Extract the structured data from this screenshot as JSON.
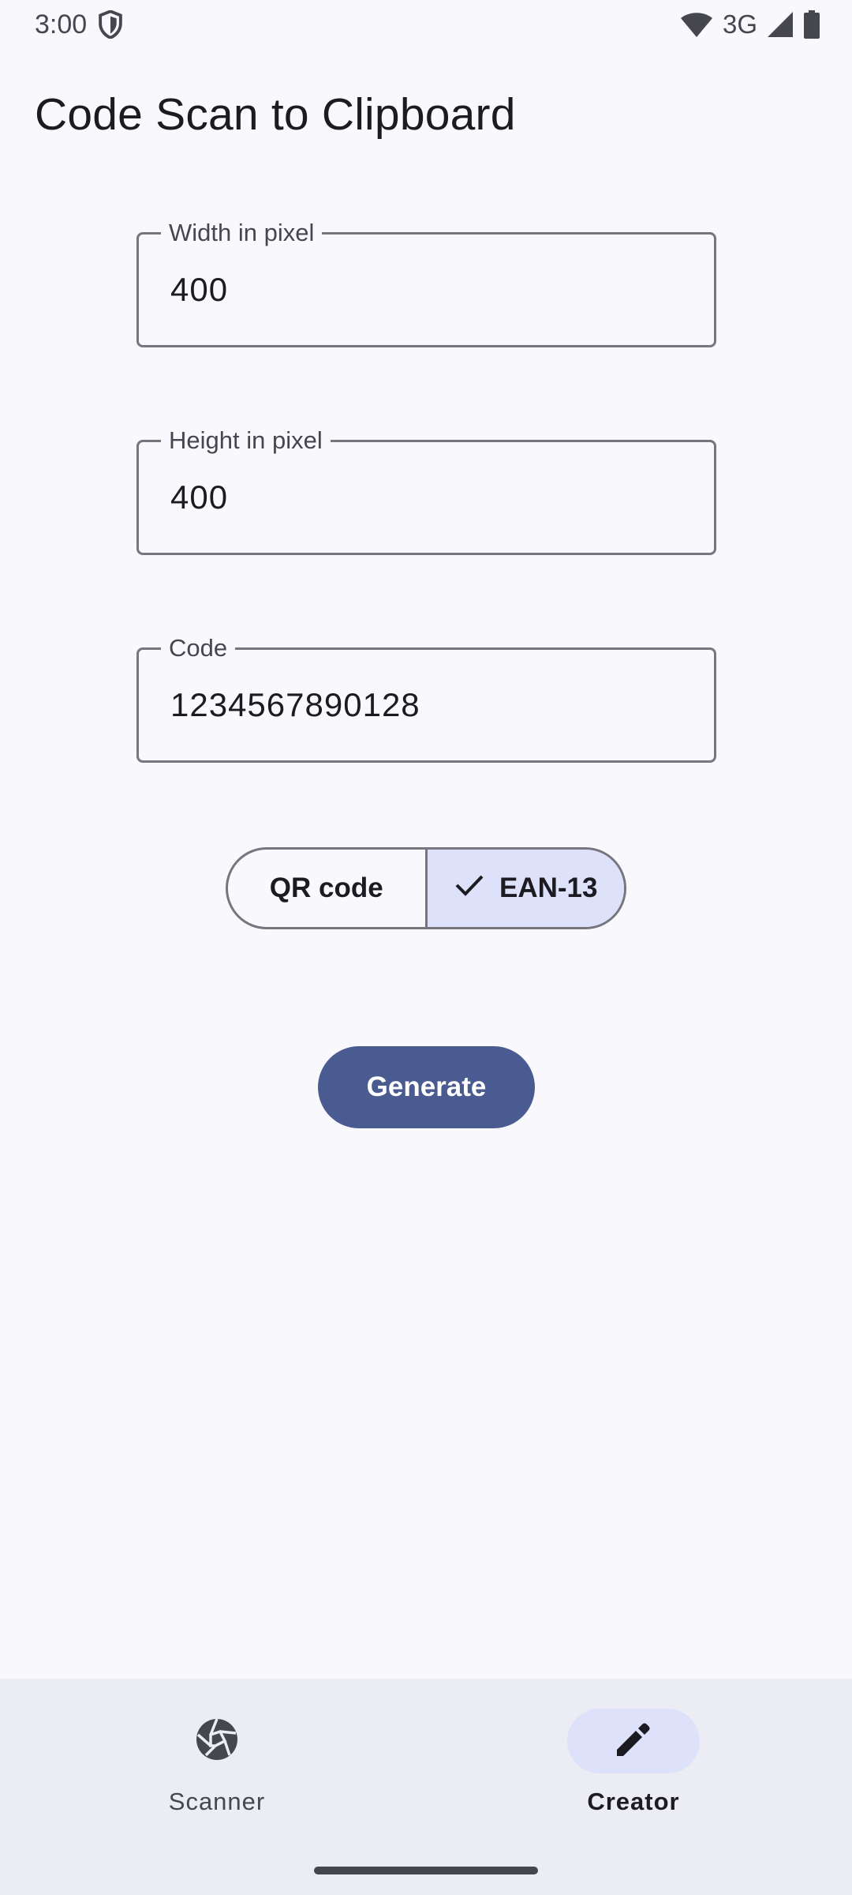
{
  "status_bar": {
    "time": "3:00",
    "network": "3G",
    "icons": [
      "shield-icon",
      "wifi-icon",
      "cell-signal-icon",
      "battery-icon"
    ]
  },
  "app": {
    "title": "Code Scan to Clipboard"
  },
  "form": {
    "width": {
      "label": "Width in pixel",
      "value": "400"
    },
    "height": {
      "label": "Height in pixel",
      "value": "400"
    },
    "code": {
      "label": "Code",
      "value": "1234567890128"
    }
  },
  "code_type": {
    "options": [
      {
        "label": "QR code",
        "selected": false
      },
      {
        "label": "EAN-13",
        "selected": true
      }
    ],
    "selected_icon": "check-icon"
  },
  "generate_label": "Generate",
  "bottom_nav": {
    "items": [
      {
        "label": "Scanner",
        "icon": "camera-aperture-icon",
        "active": false
      },
      {
        "label": "Creator",
        "icon": "pencil-icon",
        "active": true
      }
    ]
  },
  "colors": {
    "background": "#f8f8fd",
    "primary": "#4a5b92",
    "selected_container": "#dde1f9",
    "outline": "#76767f",
    "nav_background": "#ececf4"
  }
}
